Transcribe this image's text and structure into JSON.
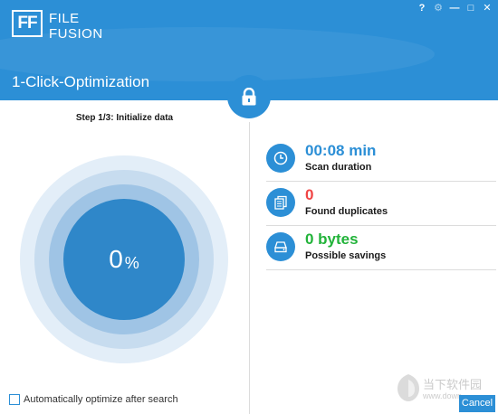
{
  "app": {
    "logo_mark": "FF",
    "logo_line1": "FILE",
    "logo_line2": "FUSION",
    "title": "1-Click-Optimization"
  },
  "window_controls": {
    "help": "?",
    "settings": "⚙",
    "minimize": "—",
    "maximize": "□",
    "close": "✕"
  },
  "step": {
    "label": "Step 1/3: Initialize data"
  },
  "progress": {
    "value": "0",
    "unit": "%"
  },
  "stats": [
    {
      "value": "00:08 min",
      "label": "Scan duration",
      "icon": "clock-icon",
      "color": "#2c8fd6"
    },
    {
      "value": "0",
      "label": "Found duplicates",
      "icon": "documents-icon",
      "color": "#f04545"
    },
    {
      "value": "0 bytes",
      "label": "Possible savings",
      "icon": "drive-icon",
      "color": "#22b33a"
    }
  ],
  "auto_optimize": {
    "label": "Automatically optimize after search",
    "checked": false
  },
  "cancel_label": "Cancel",
  "watermark": {
    "text": "当下软件园",
    "url": "www.down"
  },
  "colors": {
    "accent": "#2c8fd6",
    "red": "#f04545",
    "green": "#22b33a"
  }
}
